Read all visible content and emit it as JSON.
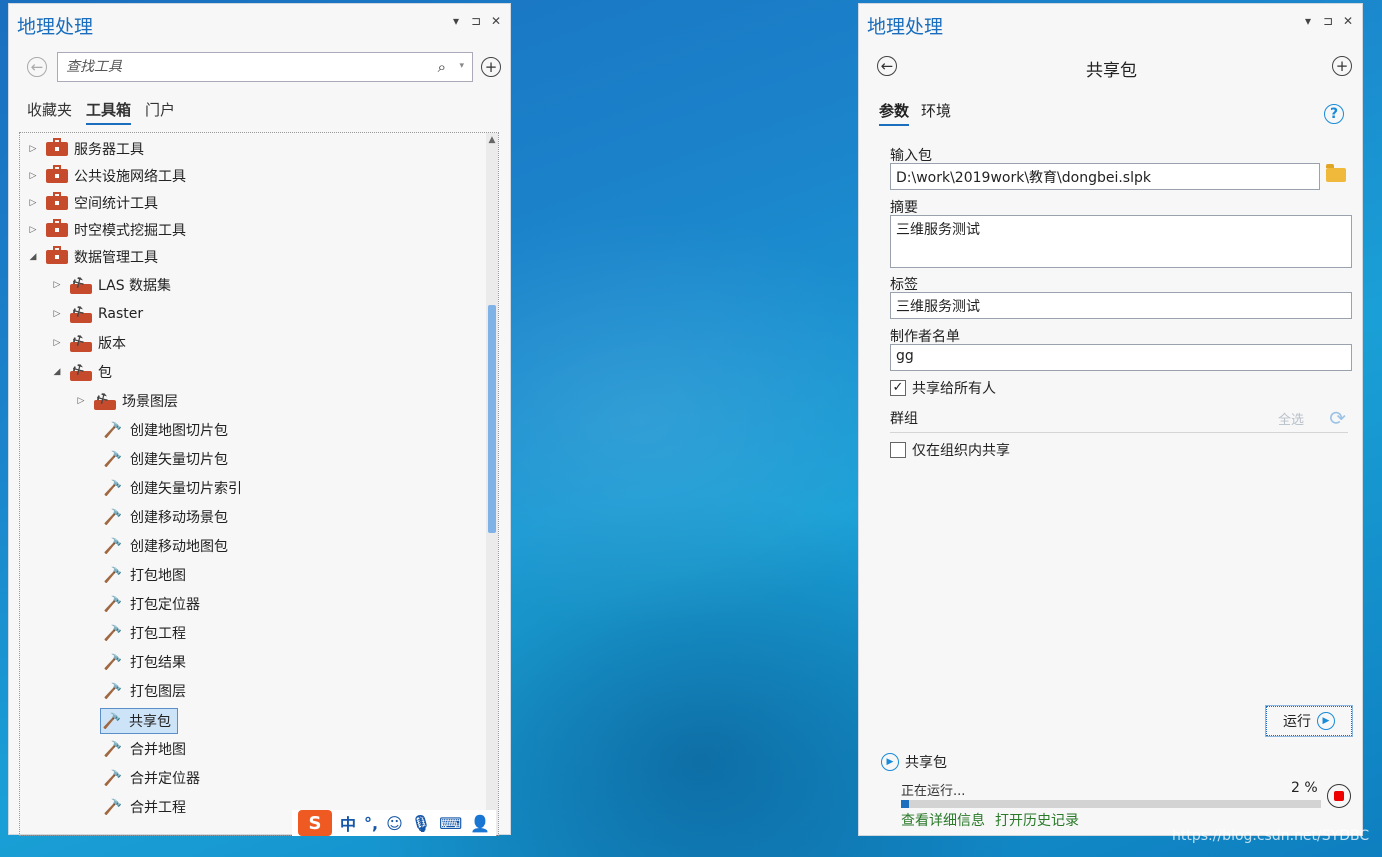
{
  "left_panel": {
    "title": "地理处理",
    "search_placeholder": "查找工具",
    "tabs": [
      "收藏夹",
      "工具箱",
      "门户"
    ],
    "tree": [
      {
        "label": "服务器工具"
      },
      {
        "label": "公共设施网络工具"
      },
      {
        "label": "空间统计工具"
      },
      {
        "label": "时空模式挖掘工具"
      },
      {
        "label": "数据管理工具"
      },
      {
        "label": "LAS 数据集"
      },
      {
        "label": "Raster"
      },
      {
        "label": "版本"
      },
      {
        "label": "包"
      },
      {
        "label": "场景图层"
      },
      {
        "label": "创建地图切片包"
      },
      {
        "label": "创建矢量切片包"
      },
      {
        "label": "创建矢量切片索引"
      },
      {
        "label": "创建移动场景包"
      },
      {
        "label": "创建移动地图包"
      },
      {
        "label": "打包地图"
      },
      {
        "label": "打包定位器"
      },
      {
        "label": "打包工程"
      },
      {
        "label": "打包结果"
      },
      {
        "label": "打包图层"
      },
      {
        "label": "共享包"
      },
      {
        "label": "合并地图"
      },
      {
        "label": "合并定位器"
      },
      {
        "label": "合并工程"
      }
    ]
  },
  "ime": {
    "chinese_label": "中",
    "punct_label": "°,"
  },
  "right_panel": {
    "title": "地理处理",
    "tool_name": "共享包",
    "tabs": [
      "参数",
      "环境"
    ],
    "help_label": "?",
    "fields": {
      "input_label": "输入包",
      "input_value": "D:\\work\\2019work\\教育\\dongbei.slpk",
      "summary_label": "摘要",
      "summary_value": "三维服务测试",
      "tags_label": "标签",
      "tags_value": "三维服务测试",
      "credits_label": "制作者名单",
      "credits_value": "gg",
      "share_everyone_label": "共享给所有人",
      "share_everyone_checked": true,
      "groups_label": "群组",
      "select_all_label": "全选",
      "org_only_label": "仅在组织内共享",
      "org_only_checked": false
    },
    "run_label": "运行",
    "status": {
      "tool_name": "共享包",
      "message": "正在运行...",
      "percent_text": "2 %",
      "progress": 0.02,
      "details_link": "查看详细信息",
      "history_link": "打开历史记录"
    }
  },
  "watermark": "https://blog.csdn.net/SYDBC"
}
